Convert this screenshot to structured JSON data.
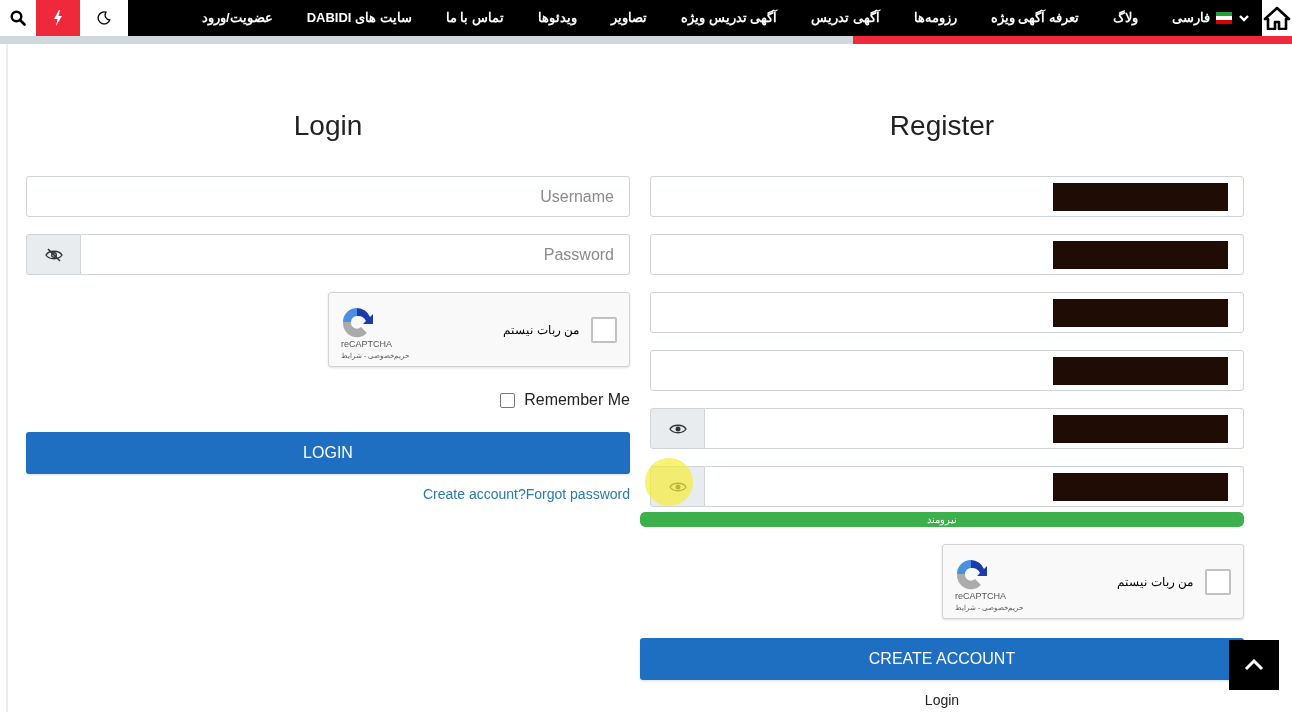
{
  "nav": {
    "items": [
      {
        "label": "فارسی",
        "kind": "language"
      },
      {
        "label": "ولاگ",
        "kind": "link"
      },
      {
        "label": "تعرفه آگهی ویژه",
        "kind": "link"
      },
      {
        "label": "رزومه‌ها",
        "kind": "link"
      },
      {
        "label": "آگهی تدریس",
        "kind": "link"
      },
      {
        "label": "آگهی تدریس ویژه",
        "kind": "link"
      },
      {
        "label": "تصاویر",
        "kind": "link"
      },
      {
        "label": "ویدئوها",
        "kind": "link"
      },
      {
        "label": "تماس با ما",
        "kind": "link"
      },
      {
        "label": "سایت های DABIDI",
        "kind": "link"
      },
      {
        "label": "عضویت/ورود",
        "kind": "link"
      }
    ],
    "dark_mode": false
  },
  "scroll_progress": {
    "level": 0.34
  },
  "login": {
    "title": "Login",
    "fields": [
      {
        "placeholder": "Username",
        "kind": "text"
      },
      {
        "placeholder": "Password",
        "kind": "password",
        "reveal": false
      }
    ],
    "captcha": {
      "label": "من ربات نیستم",
      "brand": "reCAPTCHA",
      "terms": "حریم‌خصوصی - شرایط",
      "checked": false
    },
    "remember": {
      "label": "Remember Me",
      "checked": false
    },
    "button": "LOGIN",
    "links": "Create account?Forgot password"
  },
  "register": {
    "title": "Register",
    "fields": [
      {
        "kind": "text",
        "redacted": true
      },
      {
        "kind": "text",
        "redacted": true
      },
      {
        "kind": "text",
        "redacted": true
      },
      {
        "kind": "text",
        "redacted": true
      },
      {
        "kind": "password",
        "reveal": true,
        "redacted": true
      },
      {
        "kind": "password",
        "reveal": true,
        "redacted": true
      }
    ],
    "strength": {
      "label": "نیرومند",
      "level": 1
    },
    "captcha": {
      "label": "من ربات نیستم",
      "brand": "reCAPTCHA",
      "terms": "حریم‌خصوصی - شرایط",
      "checked": false
    },
    "button": "CREATE ACCOUNT",
    "link": "Login"
  }
}
